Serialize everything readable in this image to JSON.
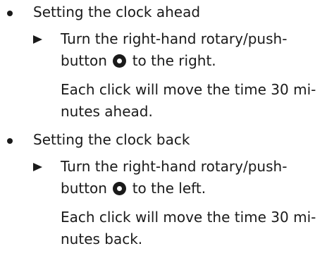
{
  "sections": [
    {
      "heading": "Setting the clock ahead",
      "step_line1": "Turn the right-hand rotary/push-",
      "step_line2_before": "button",
      "step_line2_after": "to the right.",
      "result_line1": "Each click will move the time 30 mi-",
      "result_line2": "nutes ahead."
    },
    {
      "heading": "Setting the clock back",
      "step_line1": "Turn the right-hand rotary/push-",
      "step_line2_before": "button",
      "step_line2_after": "to the left.",
      "result_line1": "Each click will move the time 30 mi-",
      "result_line2": "nutes back."
    }
  ],
  "icons": {
    "bullet": "bullet-dot-icon",
    "step": "triangle-arrow-icon",
    "knob": "rotary-knob-icon"
  }
}
